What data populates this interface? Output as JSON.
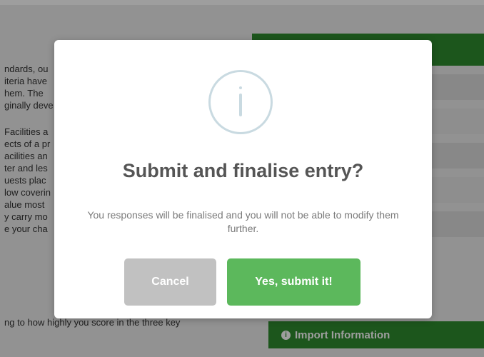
{
  "background": {
    "left_text_lines_1": [
      "ndards, ou",
      "iteria have",
      "hem. The",
      "ginally deve"
    ],
    "left_text_lines_2": [
      "Facilities a",
      "ects of a pr",
      "acilities an",
      "ter and les",
      "uests plac",
      "low coverin",
      "alue most",
      "y carry mo",
      "e your cha"
    ],
    "bottom_line": "ng to how highly you score in the three key",
    "import_label": "Import Information"
  },
  "modal": {
    "icon": "info-icon",
    "title": "Submit and finalise entry?",
    "body": "You responses will be finalised and you will not be able to modify them further.",
    "cancel_label": "Cancel",
    "confirm_label": "Yes, submit it!"
  },
  "colors": {
    "brand_green": "#2e8b2e",
    "confirm_green": "#5cb85c",
    "cancel_gray": "#c1c1c1",
    "icon_ring": "#c9dae1"
  }
}
